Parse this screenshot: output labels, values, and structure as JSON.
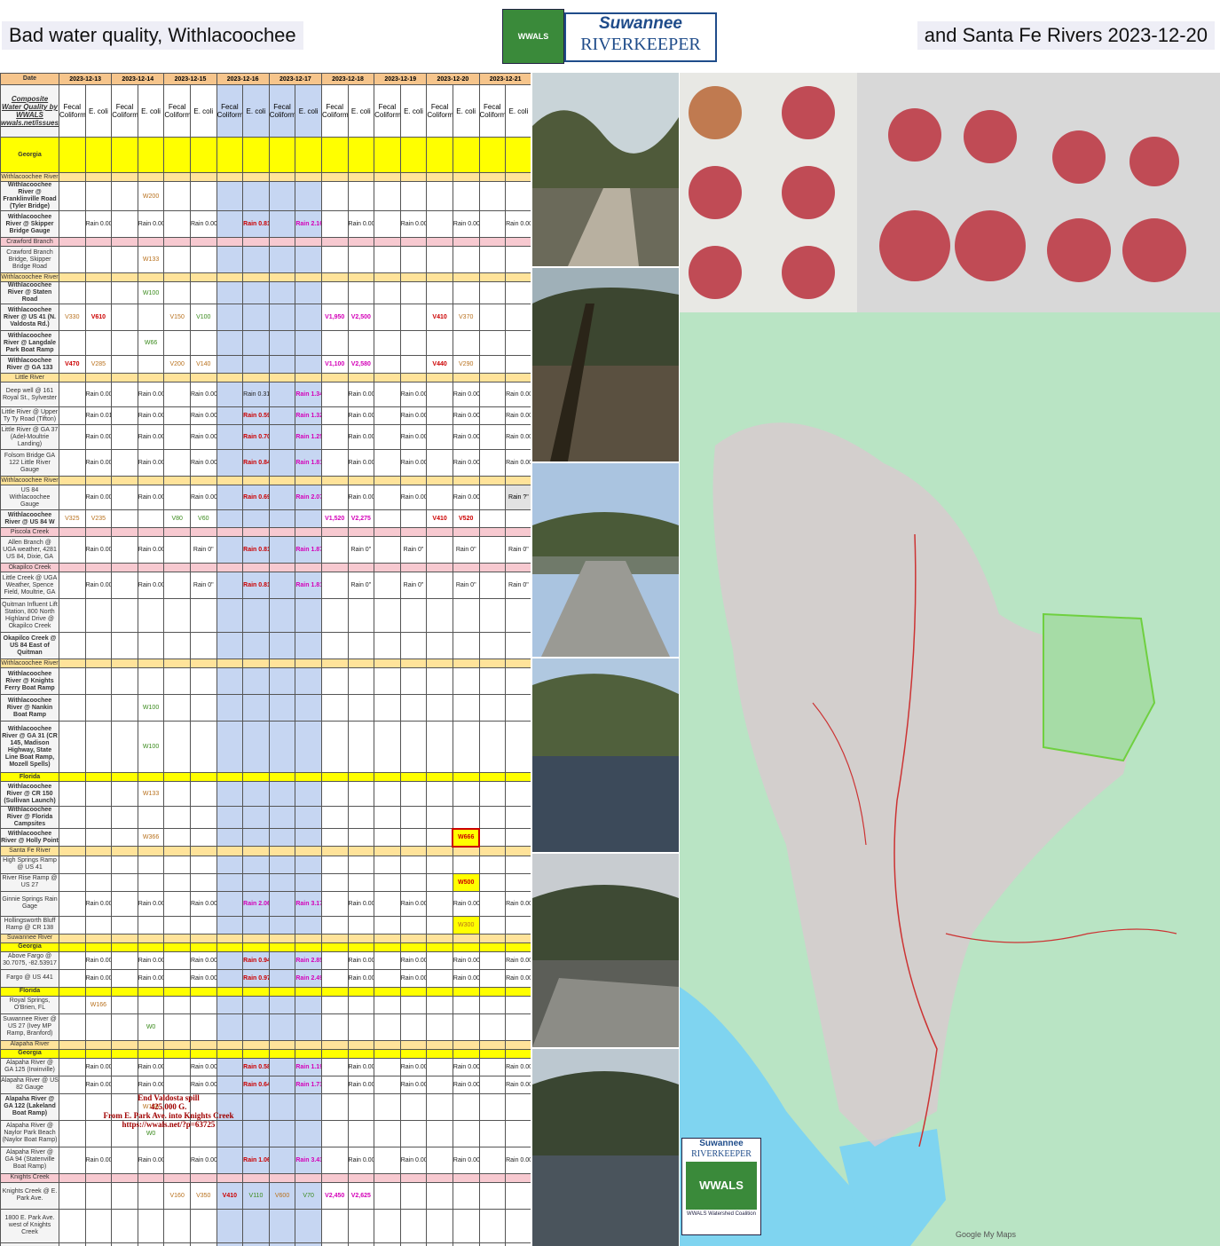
{
  "title_left": "Bad water quality, Withlacoochee",
  "title_right": "and Santa Fe Rivers 2023-12-20",
  "logo": {
    "riverkeeper_line1": "Suwannee",
    "riverkeeper_line2": "RIVERKEEPER",
    "wwals": "WWALS"
  },
  "table": {
    "date_label": "Date",
    "dates": [
      "2023-12-13",
      "2023-12-14",
      "2023-12-15",
      "2023-12-16",
      "2023-12-17",
      "2023-12-18",
      "2023-12-19",
      "2023-12-20",
      "2023-12-21"
    ],
    "header_label": "Composite Water Quality by WWALS wwals.net/issues/testing/",
    "col_fecal": "Fecal Coliform",
    "col_ecoli": "E. coli"
  },
  "map_logo": {
    "line1": "Suwannee",
    "line2": "RIVERKEEPER",
    "wwals": "WWALS",
    "coalition": "WWALS Watershed Coalition"
  },
  "spill_note": {
    "l1": "End Valdosta spill",
    "l2": "425,000 G.",
    "l3": "From E. Park Ave. into Knights Creek",
    "l4": "https://wwals.net/?p=63725"
  },
  "google": "Google My Maps",
  "colors": {
    "region": "#ffff00",
    "subregion": "#ffe39a",
    "weekend": "#c6d6f2",
    "date_row": "#f6c58c"
  }
}
